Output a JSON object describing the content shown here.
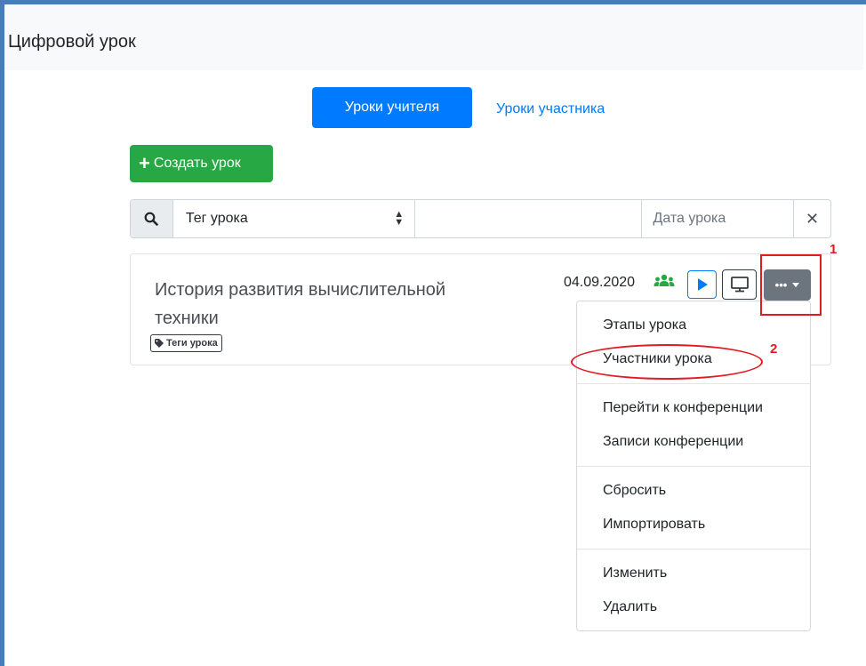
{
  "header": {
    "title": "Цифровой урок"
  },
  "tabs": [
    {
      "label": "Уроки учителя",
      "active": true
    },
    {
      "label": "Уроки участника",
      "active": false
    }
  ],
  "create_button": {
    "label": "Создать урок"
  },
  "filter": {
    "tag_select_value": "Тег урока",
    "search_value": "",
    "date_placeholder": "Дата урока"
  },
  "lesson": {
    "title": "История развития вычислительной техники",
    "date": "04.09.2020",
    "tags_label": "Теги урока"
  },
  "annotations": {
    "marker1": "1",
    "marker2": "2",
    "color": "#e01b24"
  },
  "menu": {
    "groups": [
      [
        "Этапы урока",
        "Участники урока"
      ],
      [
        "Перейти к конференции",
        "Записи конференции"
      ],
      [
        "Сбросить",
        "Импортировать"
      ],
      [
        "Изменить",
        "Удалить"
      ]
    ]
  },
  "colors": {
    "primary": "#007bff",
    "success": "#28a745",
    "secondary": "#6c757d",
    "frame": "#4a7ab8"
  }
}
